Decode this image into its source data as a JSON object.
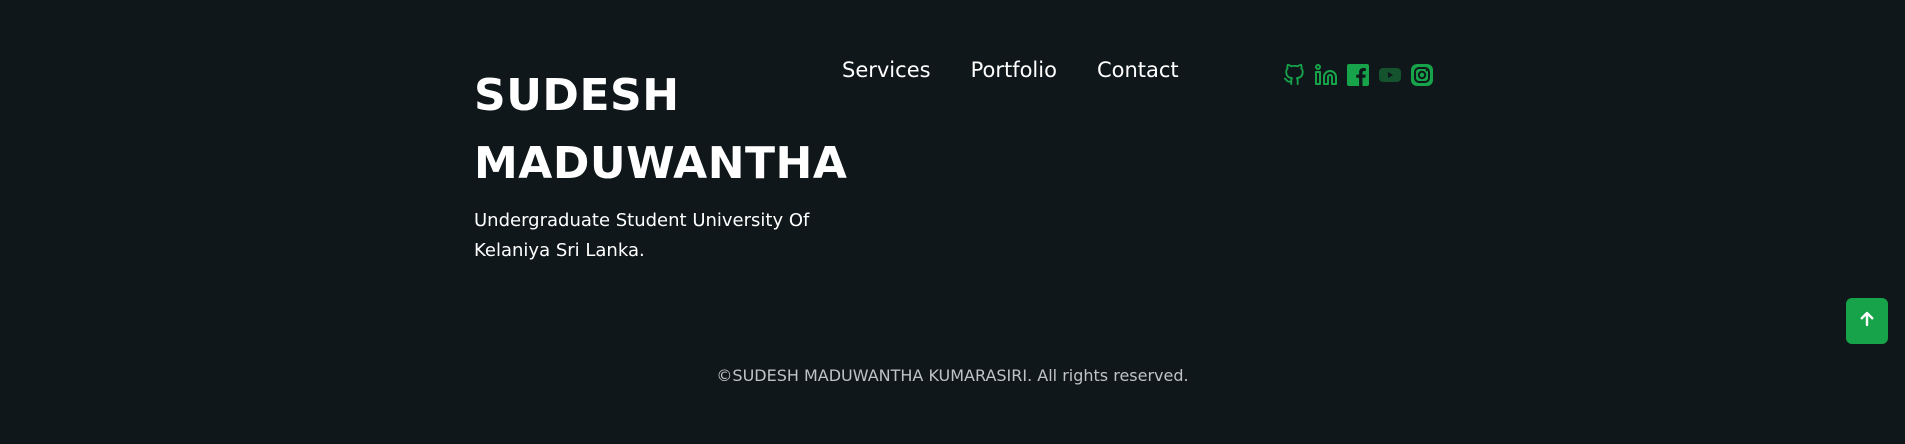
{
  "brand": {
    "name_line1": "SUDESH",
    "name_line2": "MADUWANTHA",
    "tagline": "Undergraduate Student University Of Kelaniya Sri Lanka."
  },
  "nav": {
    "items": [
      {
        "label": "Services"
      },
      {
        "label": "Portfolio"
      },
      {
        "label": "Contact"
      }
    ]
  },
  "social": {
    "icons": [
      "github-icon",
      "linkedin-icon",
      "facebook-icon",
      "youtube-icon",
      "instagram-icon"
    ]
  },
  "copyright": "©SUDESH MADUWANTHA KUMARASIRI. All rights reserved.",
  "colors": {
    "background": "#0f171a",
    "accent": "#16a34a",
    "text": "#ffffff",
    "muted_text": "#bfc3c5"
  }
}
